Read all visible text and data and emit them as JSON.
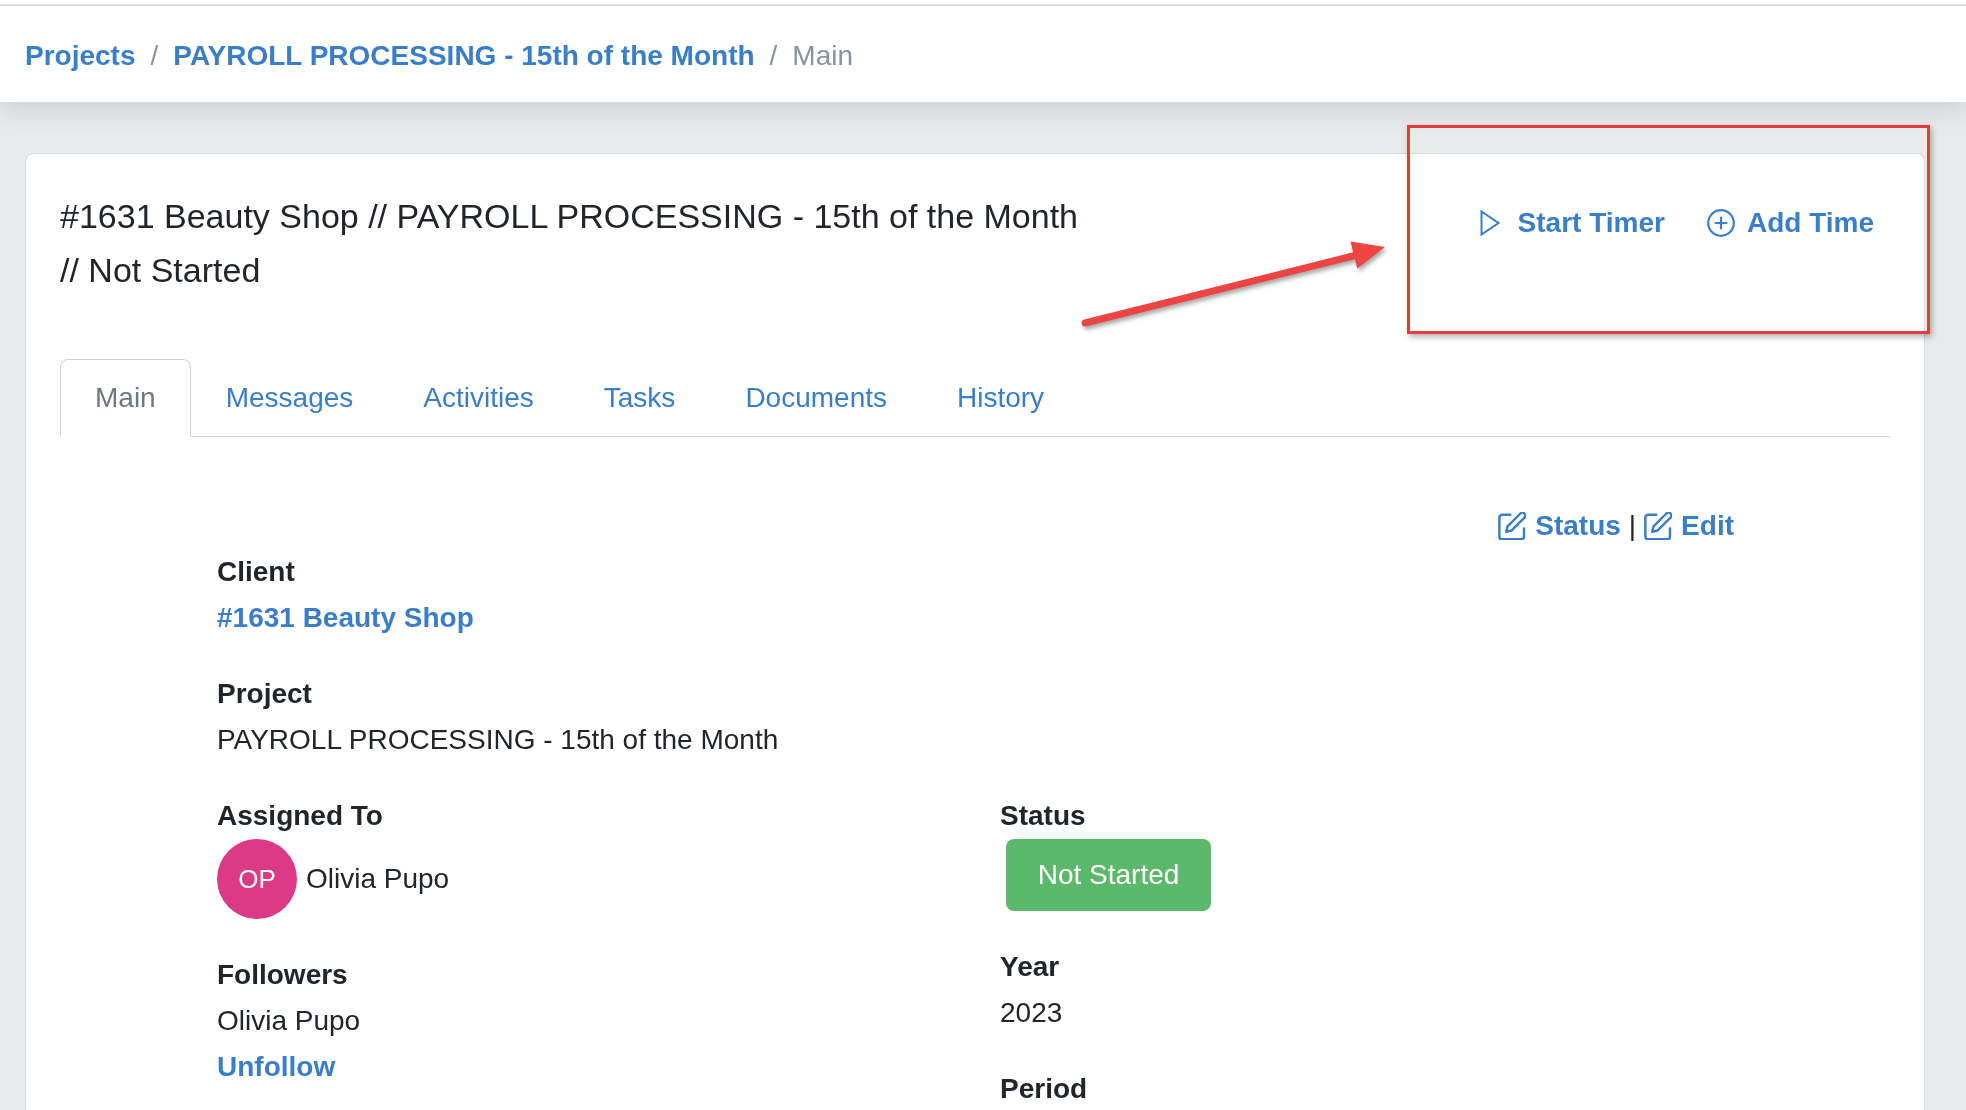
{
  "breadcrumb": [
    {
      "label": "Projects",
      "kind": "link"
    },
    {
      "separator": "/",
      "label": "PAYROLL PROCESSING - 15th of the Month",
      "kind": "link"
    },
    {
      "separator": "/",
      "label": "Main",
      "kind": "current"
    }
  ],
  "header": {
    "title": "#1631 Beauty Shop // PAYROLL PROCESSING - 15th of the Month // Not Started",
    "actions": [
      {
        "label": "Start Timer",
        "kind": "play"
      },
      {
        "label": "Add Time",
        "kind": "add"
      }
    ]
  },
  "tabs": [
    {
      "label": "Main",
      "selected": true
    },
    {
      "label": "Messages",
      "selected": false
    },
    {
      "label": "Activities",
      "selected": false
    },
    {
      "label": "Tasks",
      "selected": false
    },
    {
      "label": "Documents",
      "selected": false
    },
    {
      "label": "History",
      "selected": false
    }
  ],
  "panel_actions": {
    "items": [
      {
        "label": "Status",
        "kind": "edit"
      },
      {
        "label": "Edit",
        "kind": "edit"
      }
    ],
    "separator": "|"
  },
  "details": {
    "rows": [
      {
        "label": "Client",
        "kind": "link",
        "value": "#1631 Beauty Shop"
      },
      {
        "label": "Project",
        "kind": "text",
        "value": "PAYROLL PROCESSING - 15th of the Month"
      }
    ],
    "left_column": [
      {
        "label": "Assigned To",
        "kind": "person",
        "initials": "OP",
        "value": "Olivia Pupo"
      },
      {
        "label": "Followers",
        "kind": "followers",
        "value": "Olivia Pupo",
        "action": "Unfollow"
      }
    ],
    "right_column": [
      {
        "label": "Status",
        "kind": "badge",
        "value": "Not Started"
      },
      {
        "label": "Year",
        "kind": "text",
        "value": "2023"
      },
      {
        "label": "Period",
        "kind": "text"
      }
    ]
  }
}
